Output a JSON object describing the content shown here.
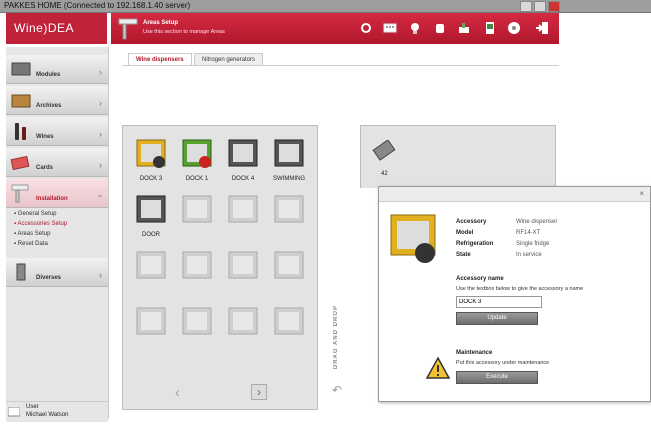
{
  "window": {
    "title": "PAKKES HOME (Connected to 192.168.1.40 server)"
  },
  "brand": {
    "logo_text": "Wine)DEA",
    "accent": "#c0223a"
  },
  "header": {
    "title": "Areas Setup",
    "subtitle": "Use this section to manage Areas",
    "icons": [
      "record-icon",
      "keyboard-icon",
      "bulb-icon",
      "hand-icon",
      "tools-icon",
      "phone-icon",
      "settings-icon",
      "logout-icon"
    ]
  },
  "sidebar": {
    "items": [
      {
        "label": "Modules",
        "icon": "modules-icon"
      },
      {
        "label": "Archives",
        "icon": "archives-icon"
      },
      {
        "label": "Wines",
        "icon": "wines-icon"
      },
      {
        "label": "Cards",
        "icon": "cards-icon"
      },
      {
        "label": "Installation",
        "icon": "installation-icon"
      },
      {
        "label": "Diverses",
        "icon": "diverses-icon"
      }
    ],
    "subitems": [
      {
        "label": "General Setup"
      },
      {
        "label": "Accessories Setup"
      },
      {
        "label": "Areas Setup"
      },
      {
        "label": "Reset Data"
      }
    ],
    "user": {
      "label": "User",
      "name": "Michael Watson"
    }
  },
  "tabs": [
    {
      "label": "Wine dispensers"
    },
    {
      "label": "Nitrogen generators"
    }
  ],
  "docks": [
    {
      "label": "DOCK 3",
      "color": "#e0b020"
    },
    {
      "label": "DOCK 1",
      "color": "#5aa030"
    },
    {
      "label": "DOCK 4",
      "color": "#555555"
    },
    {
      "label": "SWIMMING",
      "color": "#555555"
    },
    {
      "label": "DOOR",
      "color": "#555555"
    }
  ],
  "drag_label": "DRAG AND DROP",
  "right_item": {
    "label": "42"
  },
  "popup": {
    "props": [
      {
        "key": "Accessory",
        "value": "Wine dispenser"
      },
      {
        "key": "Model",
        "value": "RF14-XT"
      },
      {
        "key": "Refrigeration",
        "value": "Single fridge"
      },
      {
        "key": "State",
        "value": "In service"
      }
    ],
    "name_section": "Accessory name",
    "name_hint": "Use the textbox below to give the accessory a name",
    "name_value": "DOCK 3",
    "update_label": "Update",
    "maint_section": "Maintenance",
    "maint_hint": "Put this accessory under maintenance",
    "execute_label": "Execute",
    "close": "×"
  }
}
